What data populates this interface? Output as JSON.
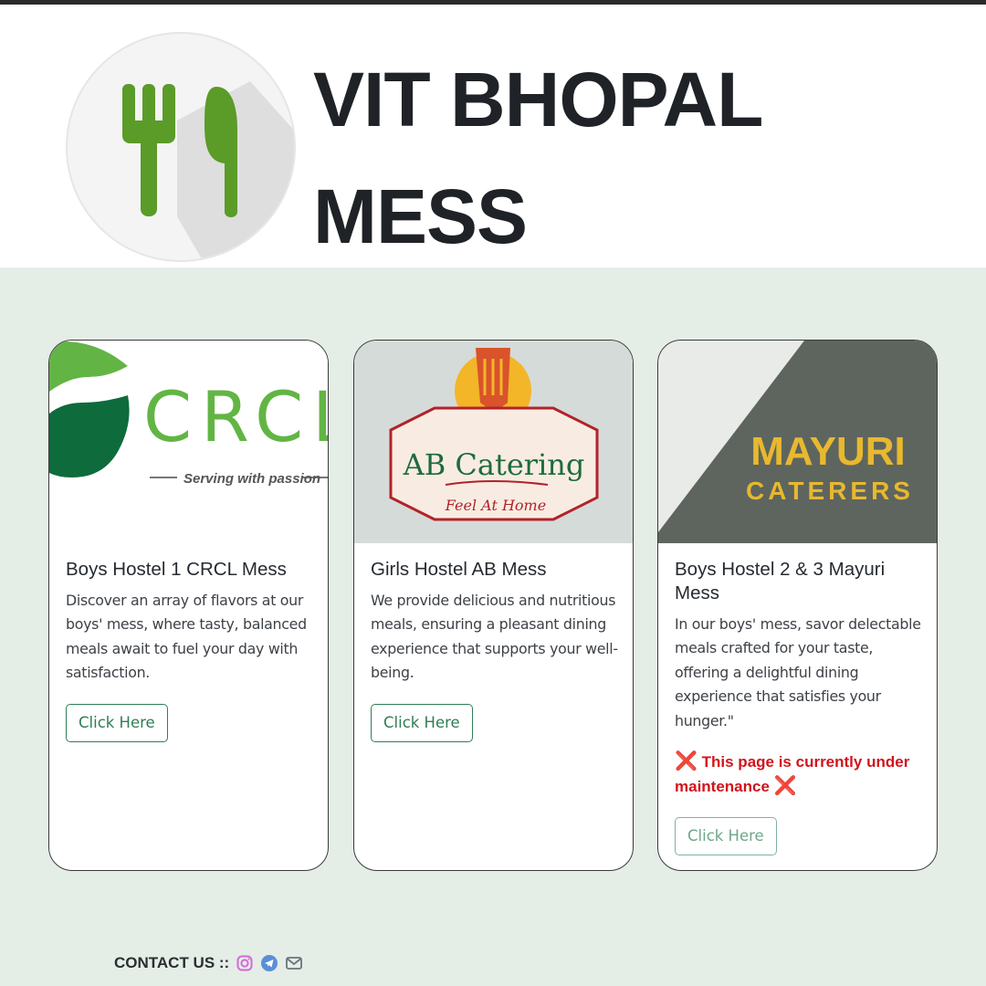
{
  "header": {
    "title_line1": "VIT BHOPAL",
    "title_line2": "MESS",
    "logo_icon": "fork-knife-icon",
    "logo_color": "#5b9b28"
  },
  "cards": [
    {
      "image_text": "CRCL",
      "image_tagline": "Serving with passion",
      "title": "Boys Hostel 1 CRCL Mess",
      "description": "Discover an array of flavors at our boys' mess, where tasty, balanced meals await to fuel your day with satisfaction.",
      "button_label": "Click Here"
    },
    {
      "image_text": "AB Catering",
      "image_tagline": "Feel At Home",
      "title": "Girls Hostel AB Mess",
      "description": "We provide delicious and nutritious meals, ensuring a pleasant dining experience that supports your well-being.",
      "button_label": "Click Here"
    },
    {
      "image_text": "MAYURI",
      "image_tagline": "CATERERS",
      "title": "Boys Hostel 2 & 3 Mayuri Mess",
      "description": "In our boys' mess, savor delectable meals crafted for your taste, offering a delightful dining experience that satisfies your hunger.\"",
      "warning_icon": "❌",
      "warning": "This page is currently under maintenance",
      "button_label": "Click Here"
    }
  ],
  "footer": {
    "contact_label": "CONTACT US ::",
    "icons": [
      "instagram-icon",
      "telegram-icon",
      "mail-icon"
    ]
  },
  "colors": {
    "page_bg": "#e5ede7",
    "accent": "#2f7d55",
    "warning": "#d1141c"
  }
}
